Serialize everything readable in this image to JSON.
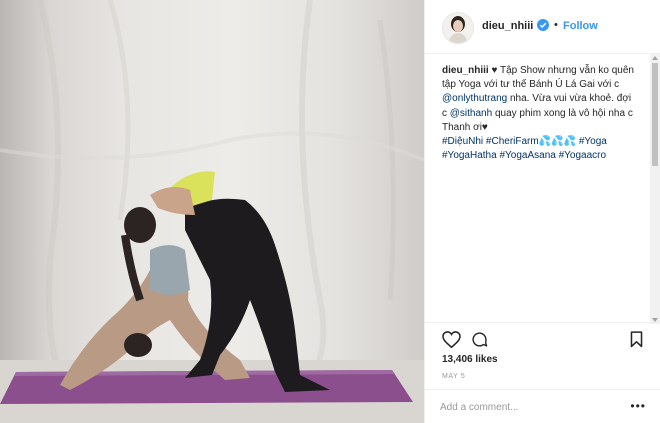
{
  "post": {
    "username": "dieu_nhiii",
    "verified_icon": "verified-badge-icon",
    "separator": "•",
    "follow_label": "Follow"
  },
  "caption": {
    "username": "dieu_nhiii",
    "text_1": " ♥ Tập Show nhưng vẫn ko quên tập Yoga với tư thế Bánh Ú Lá Gai với c ",
    "mention_1": "@onlythutrang",
    "text_2": " nha. Vừa vui vừa khoẻ. đợi c ",
    "mention_2": "@sithanh",
    "text_3": " quay phim xong là vô hội nha c Thanh ơi♥ ",
    "hashtags_line_1": "#DiệuNhi #CheriFarm💦💦💦 #Yoga",
    "hashtags_line_2": "#YogaHatha #YogaAsana #Yogaacro"
  },
  "actions": {
    "like_icon": "heart-icon",
    "comment_icon": "comment-bubble-icon",
    "save_icon": "bookmark-icon",
    "likes": "13,406 likes",
    "date": "MAY 5"
  },
  "comment": {
    "placeholder": "Add a comment...",
    "more": "•••"
  },
  "colors": {
    "link": "#3897f0",
    "hashtag": "#003569",
    "text": "#262626",
    "muted": "#999999",
    "mat": "#8a4f8c"
  }
}
